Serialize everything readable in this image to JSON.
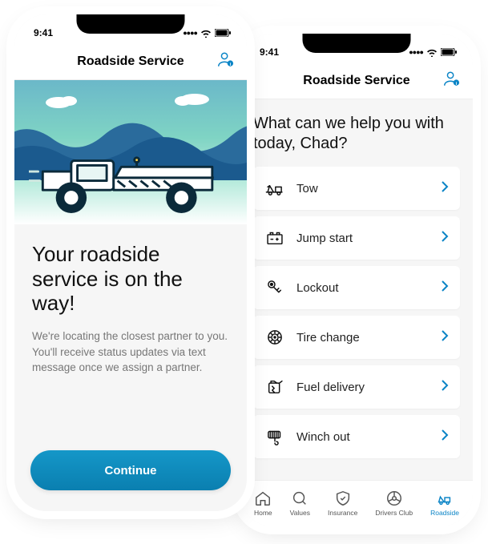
{
  "statusbar": {
    "time": "9:41"
  },
  "navbar": {
    "title": "Roadside Service"
  },
  "left": {
    "headline": "Your roadside service is on the way!",
    "subcopy": "We're locating the closest partner to you. You'll receive status updates via text message once we assign a partner.",
    "continue_label": "Continue"
  },
  "right": {
    "prompt": "What can we help you with today, Chad?",
    "options": [
      {
        "icon": "tow-icon",
        "label": "Tow"
      },
      {
        "icon": "jump-start-icon",
        "label": "Jump start"
      },
      {
        "icon": "lockout-icon",
        "label": "Lockout"
      },
      {
        "icon": "tire-change-icon",
        "label": "Tire change"
      },
      {
        "icon": "fuel-delivery-icon",
        "label": "Fuel delivery"
      },
      {
        "icon": "winch-out-icon",
        "label": "Winch out"
      }
    ],
    "tabs": [
      {
        "icon": "home-icon",
        "label": "Home",
        "active": false
      },
      {
        "icon": "values-icon",
        "label": "Values",
        "active": false
      },
      {
        "icon": "insurance-icon",
        "label": "Insurance",
        "active": false
      },
      {
        "icon": "drivers-club-icon",
        "label": "Drivers Club",
        "active": false
      },
      {
        "icon": "roadside-icon",
        "label": "Roadside",
        "active": true
      }
    ]
  }
}
